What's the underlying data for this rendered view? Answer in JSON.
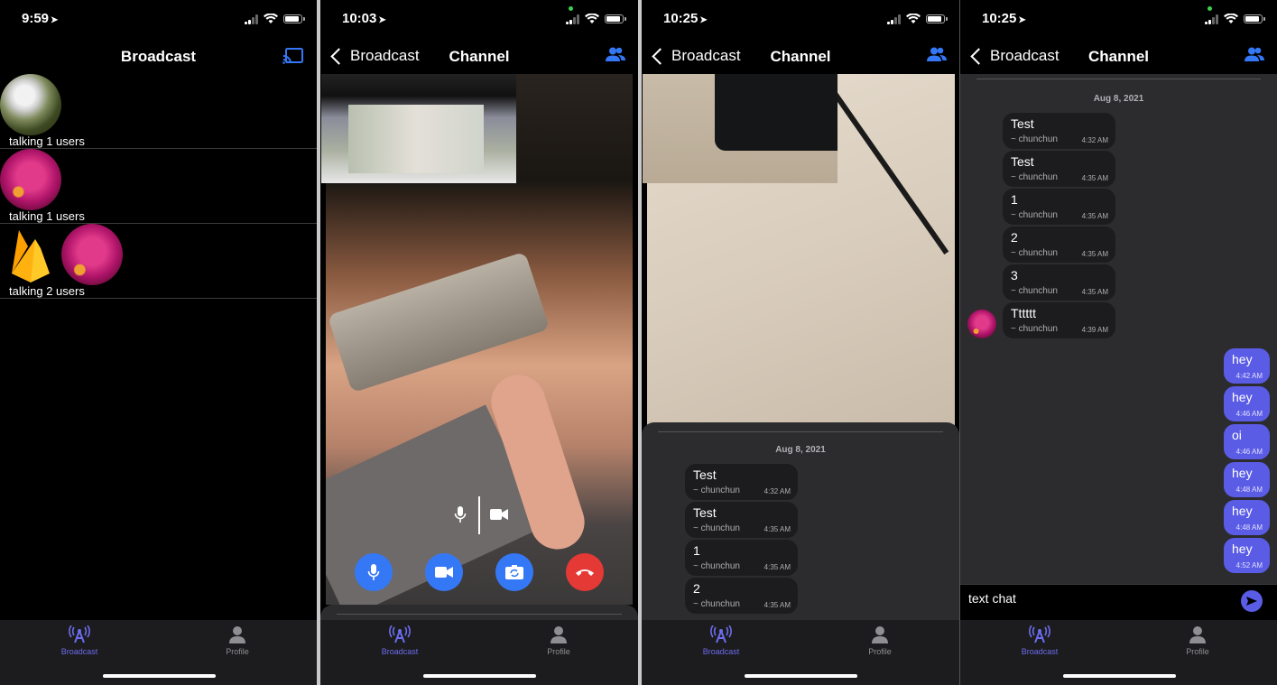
{
  "screens": [
    {
      "status_time": "9:59",
      "title": "Broadcast",
      "rooms": [
        {
          "label": "talking 1 users"
        },
        {
          "label": "talking 1 users"
        },
        {
          "label": "talking 2 users"
        }
      ]
    },
    {
      "status_time": "10:03",
      "back_label": "Broadcast",
      "title": "Channel"
    },
    {
      "status_time": "10:25",
      "back_label": "Broadcast",
      "title": "Channel",
      "date": "Aug 8, 2021",
      "messages": [
        {
          "text": "Test",
          "author": "~ chunchun",
          "time": "4:32 AM"
        },
        {
          "text": "Test",
          "author": "~ chunchun",
          "time": "4:35 AM"
        },
        {
          "text": "1",
          "author": "~ chunchun",
          "time": "4:35 AM"
        },
        {
          "text": "2",
          "author": "~ chunchun",
          "time": "4:35 AM"
        }
      ]
    },
    {
      "status_time": "10:25",
      "back_label": "Broadcast",
      "title": "Channel",
      "date": "Aug 8, 2021",
      "messages": [
        {
          "text": "Test",
          "author": "~ chunchun",
          "time": "4:32 AM"
        },
        {
          "text": "Test",
          "author": "~ chunchun",
          "time": "4:35 AM"
        },
        {
          "text": "1",
          "author": "~ chunchun",
          "time": "4:35 AM"
        },
        {
          "text": "2",
          "author": "~ chunchun",
          "time": "4:35 AM"
        },
        {
          "text": "3",
          "author": "~ chunchun",
          "time": "4:35 AM"
        },
        {
          "text": "Tttttt",
          "author": "~ chunchun",
          "time": "4:39 AM"
        }
      ],
      "my_messages": [
        {
          "text": "hey",
          "time": "4:42 AM"
        },
        {
          "text": "hey",
          "time": "4:46 AM"
        },
        {
          "text": "oi",
          "time": "4:46 AM"
        },
        {
          "text": "hey",
          "time": "4:48 AM"
        },
        {
          "text": "hey",
          "time": "4:48 AM"
        },
        {
          "text": "hey",
          "time": "4:52 AM"
        }
      ],
      "input_value": "text chat"
    }
  ],
  "tabs": {
    "broadcast": "Broadcast",
    "profile": "Profile"
  },
  "colors": {
    "accent": "#6c6cf0",
    "blue": "#3478f6",
    "end_call": "#e53935",
    "my_bubble": "#5b5ce6"
  }
}
